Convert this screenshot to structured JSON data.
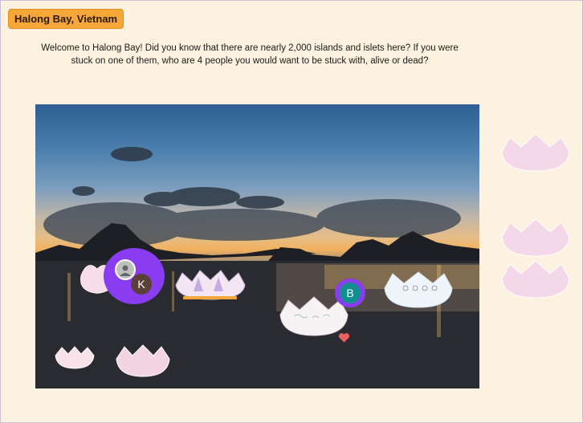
{
  "board": {
    "title": "Halong Bay, Vietnam",
    "prompt": "Welcome to Halong Bay! Did you know that there are nearly 2,000 islands and islets here? If you were stuck on one of them, who are 4 people you would want to be stuck with, alive or dead?"
  },
  "avatars": [
    {
      "initial": "K",
      "ring_color": "#8a3cf0",
      "color": "#5a4038"
    },
    {
      "initial": "B",
      "ring_color": "#8a3cf0",
      "color": "#12908f"
    }
  ],
  "colors": {
    "tag": "#f7a739",
    "background": "#fdf2e0",
    "avatar_ring": "#8a3cf0",
    "heart": "#e8605f"
  },
  "icons": [
    "heart-icon",
    "lotus-icon",
    "user-avatar-icon"
  ]
}
